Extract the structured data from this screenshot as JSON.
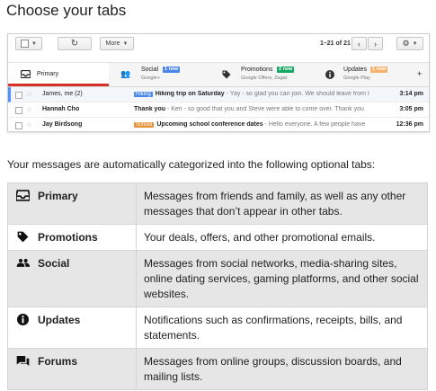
{
  "heading": "Choose your tabs",
  "gmail": {
    "toolbar": {
      "more_label": "More",
      "pager": "1–21 of 21"
    },
    "tabs": [
      {
        "name": "Primary",
        "sub": "",
        "badge": "",
        "icon": "inbox-icon"
      },
      {
        "name": "Social",
        "sub": "Google+",
        "badge": "1 new",
        "badge_color": "#4a86e8",
        "icon": "people-icon"
      },
      {
        "name": "Promotions",
        "sub": "Google Offers, Zagat",
        "badge": "2 new",
        "badge_color": "#16a765",
        "icon": "tag-icon"
      },
      {
        "name": "Updates",
        "sub": "Google Play",
        "badge": "1 new",
        "badge_color": "#f6b26b",
        "icon": "info-icon"
      }
    ],
    "rows": [
      {
        "sender": "James, me (2)",
        "label": "Hiking",
        "subject": "Hiking trip on Saturday",
        "snippet": " - Yay - so glad you can join. We should leave from I",
        "time": "3:14 pm"
      },
      {
        "sender": "Hannah Cho",
        "label": "",
        "subject": "Thank you",
        "snippet": " - Keri - so good that you and Steve were able to come over. Thank you",
        "time": "3:05 pm"
      },
      {
        "sender": "Jay Birdsong",
        "label": "School",
        "subject": "Upcoming school conference dates",
        "snippet": " - Hello everyone. A few people have",
        "time": "12:36 pm"
      }
    ]
  },
  "intro": "Your messages are automatically categorized into the following optional tabs:",
  "categories": [
    {
      "name": "Primary",
      "icon": "inbox-icon",
      "description": "Messages from friends and family, as well as any other messages that don’t appear in other tabs."
    },
    {
      "name": "Promotions",
      "icon": "tag-icon",
      "description": "Your deals, offers, and other promotional emails."
    },
    {
      "name": "Social",
      "icon": "people-icon",
      "description": "Messages from social networks, media-sharing sites, online dating services, gaming platforms, and other social websites."
    },
    {
      "name": "Updates",
      "icon": "info-icon",
      "description": "Notifications such as confirmations, receipts, bills, and statements."
    },
    {
      "name": "Forums",
      "icon": "forum-icon",
      "description": "Messages from online groups, discussion boards, and mailing lists."
    }
  ],
  "colors": {
    "accent_red": "#d93025",
    "row_shade": "#e6e6e6",
    "selection_blue": "#4d90fe"
  }
}
